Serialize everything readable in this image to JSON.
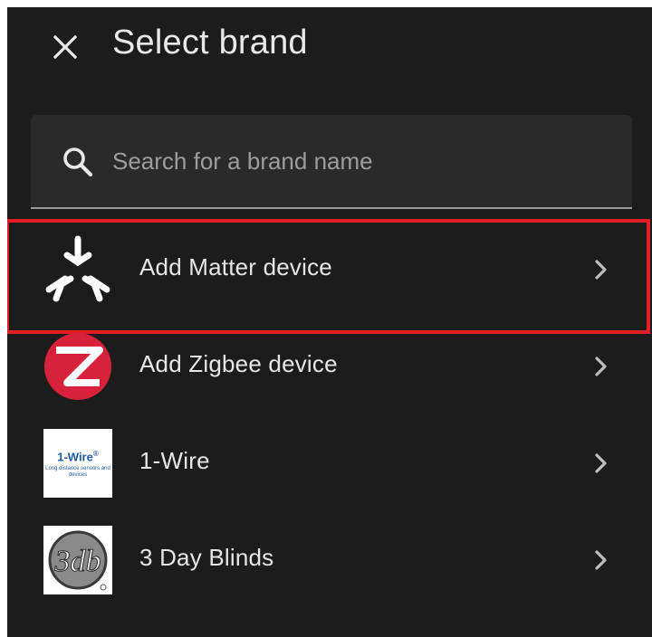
{
  "header": {
    "title": "Select brand",
    "close_icon": "close-icon"
  },
  "search": {
    "placeholder": "Search for a brand name",
    "value": "",
    "icon": "search-icon"
  },
  "brands": [
    {
      "label": "Add Matter device",
      "logo": "matter-logo",
      "highlighted": true
    },
    {
      "label": "Add Zigbee device",
      "logo": "zigbee-logo"
    },
    {
      "label": "1-Wire",
      "logo": "one-wire-logo",
      "logo_text": "1-Wire",
      "logo_mark": "®",
      "logo_subtext": "Long distance sensors and devices"
    },
    {
      "label": "3 Day Blinds",
      "logo": "three-day-blinds-logo",
      "logo_text": "3db"
    }
  ],
  "colors": {
    "background": "#1c1c1c",
    "field": "#2a2a2a",
    "highlight": "#e01e23",
    "zigbee": "#d8223b",
    "wire_blue": "#1f5aa8"
  }
}
